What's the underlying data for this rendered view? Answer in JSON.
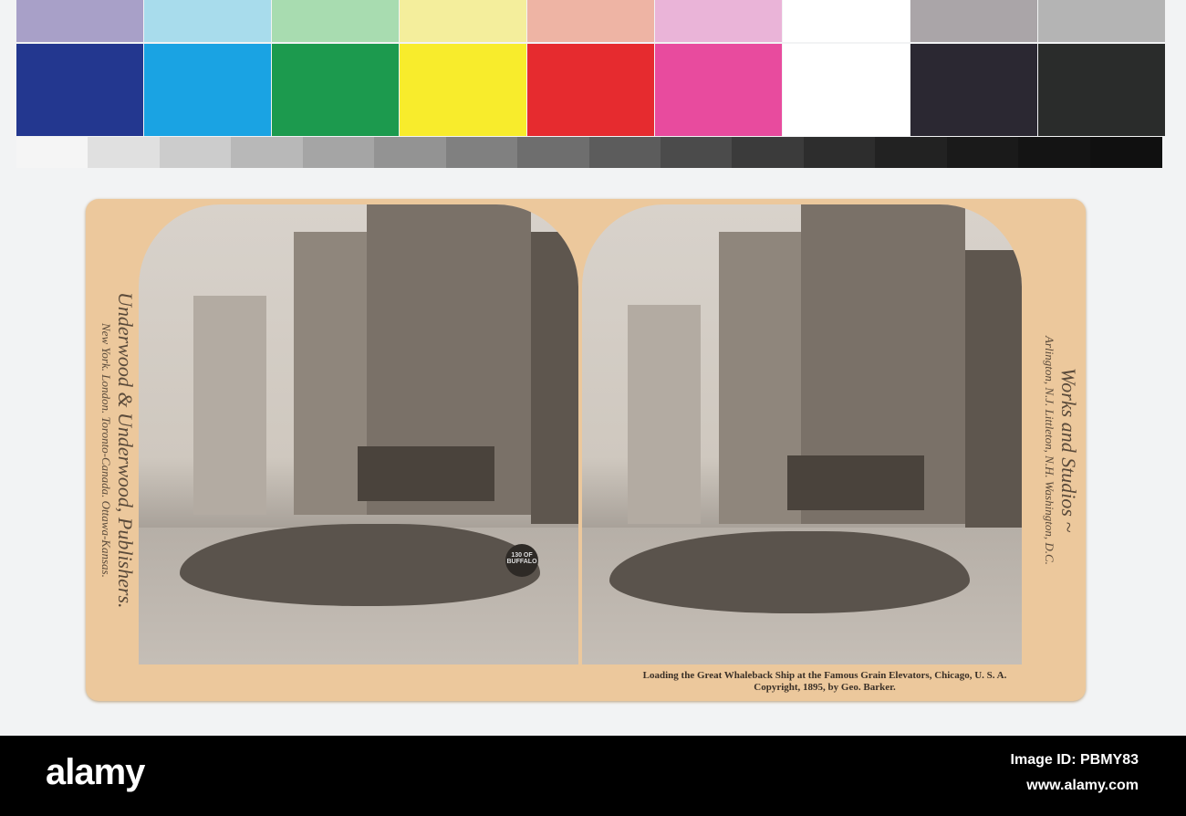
{
  "color_chart": {
    "top_row": [
      "#a8a0c8",
      "#a8dcec",
      "#a8dcb0",
      "#f4ee9c",
      "#eeb4a4",
      "#eab4d8",
      "#ffffff",
      "#aaa5a8",
      "#b4b4b4"
    ],
    "main_row": [
      "#23378f",
      "#1aa3e3",
      "#1c9a4e",
      "#f8ec2c",
      "#e62b2f",
      "#e84b9e",
      "#ffffff",
      "#2b2832",
      "#2a2c2b"
    ],
    "grayscale": [
      "#f5f5f5",
      "#e0e0e0",
      "#cccccc",
      "#b8b8b8",
      "#a5a5a5",
      "#939393",
      "#808080",
      "#6e6e6e",
      "#5c5c5c",
      "#4b4b4b",
      "#3b3b3b",
      "#2d2d2d",
      "#222222",
      "#1a1a1a",
      "#141414",
      "#101010"
    ]
  },
  "card": {
    "left_imprint_main": "Underwood & Underwood, Publishers.",
    "left_imprint_cities": "New York. London. Toronto-Canada. Ottawa-Kansas.",
    "right_imprint_main": "Works and Studios ~",
    "right_imprint_cities": "Arlington, N.J. Littleton, N.H. Washington, D.C.",
    "caption": "Loading the Great Whaleback Ship at the Famous Grain Elevators, Chicago, U. S. A.",
    "copyright": "Copyright, 1895, by Geo. Barker.",
    "ship_marking": "130 OF BUFFALO"
  },
  "footer": {
    "logo": "alamy",
    "image_id": "Image ID: PBMY83",
    "url": "www.alamy.com"
  }
}
